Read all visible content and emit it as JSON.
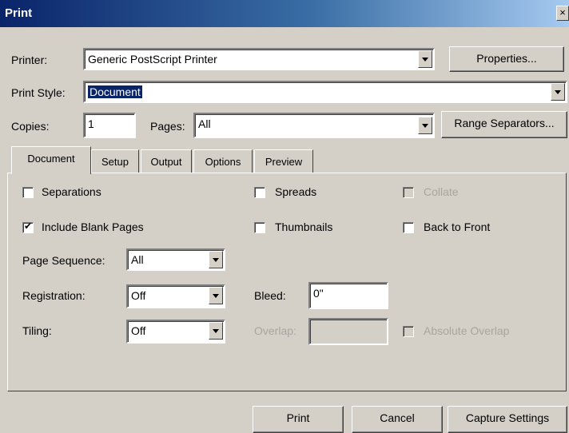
{
  "window": {
    "title": "Print",
    "close_glyph": "×"
  },
  "printer": {
    "label": "Printer:",
    "value": "Generic PostScript Printer",
    "properties_button": "Properties..."
  },
  "print_style": {
    "label": "Print Style:",
    "value": "Document"
  },
  "copies": {
    "label": "Copies:",
    "value": "1"
  },
  "pages": {
    "label": "Pages:",
    "value": "All",
    "range_separators_button": "Range Separators..."
  },
  "tabs": [
    {
      "label": "Document",
      "active": true
    },
    {
      "label": "Setup",
      "active": false
    },
    {
      "label": "Output",
      "active": false
    },
    {
      "label": "Options",
      "active": false
    },
    {
      "label": "Preview",
      "active": false
    }
  ],
  "document_tab": {
    "separations": {
      "label": "Separations",
      "checked": false
    },
    "spreads": {
      "label": "Spreads",
      "checked": false
    },
    "collate": {
      "label": "Collate",
      "checked": false,
      "disabled": true
    },
    "include_blank_pages": {
      "label": "Include Blank Pages",
      "checked": true
    },
    "thumbnails": {
      "label": "Thumbnails",
      "checked": false
    },
    "back_to_front": {
      "label": "Back to Front",
      "checked": false
    },
    "page_sequence": {
      "label": "Page Sequence:",
      "value": "All"
    },
    "registration": {
      "label": "Registration:",
      "value": "Off"
    },
    "bleed": {
      "label": "Bleed:",
      "value": "0\""
    },
    "tiling": {
      "label": "Tiling:",
      "value": "Off"
    },
    "overlap": {
      "label": "Overlap:",
      "value": "",
      "disabled": true
    },
    "absolute_overlap": {
      "label": "Absolute Overlap",
      "checked": false,
      "disabled": true
    }
  },
  "footer": {
    "print_button": "Print",
    "cancel_button": "Cancel",
    "capture_button": "Capture Settings"
  },
  "colors": {
    "title_gradient_start": "#0a246a",
    "title_gradient_end": "#a6caf0",
    "face": "#d4d0c8",
    "selection": "#0a246a"
  }
}
